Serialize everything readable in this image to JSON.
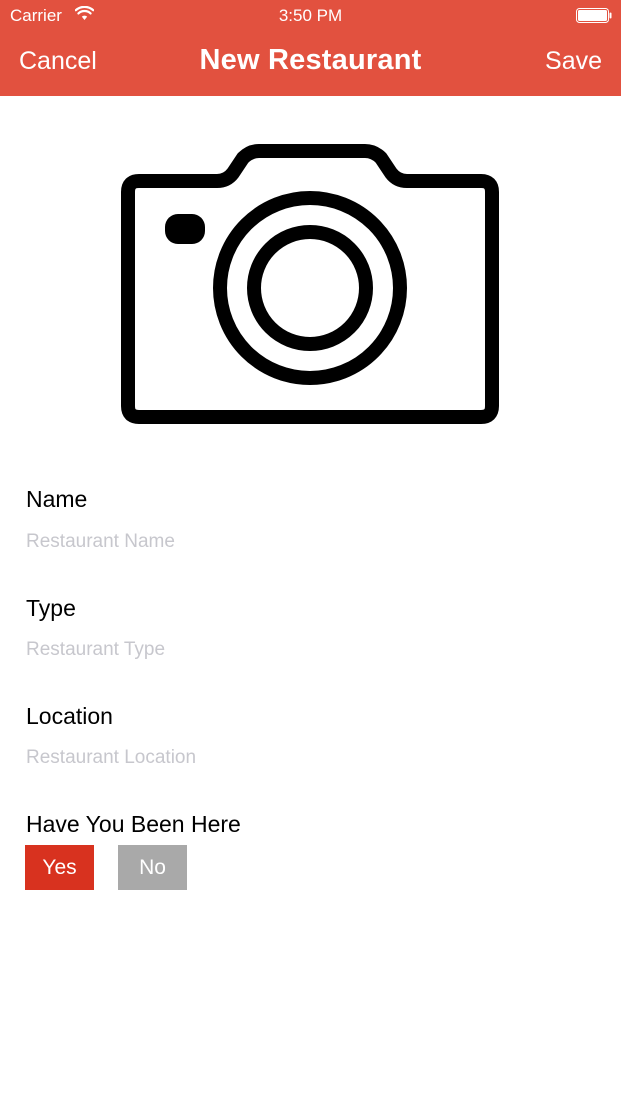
{
  "status_bar": {
    "carrier": "Carrier",
    "time": "3:50 PM",
    "wifi_icon": "wifi-icon",
    "battery_icon": "battery-icon"
  },
  "nav": {
    "cancel": "Cancel",
    "title": "New Restaurant",
    "save": "Save"
  },
  "photo": {
    "icon": "camera-icon"
  },
  "form": {
    "name": {
      "label": "Name",
      "placeholder": "Restaurant Name",
      "value": ""
    },
    "type": {
      "label": "Type",
      "placeholder": "Restaurant Type",
      "value": ""
    },
    "location": {
      "label": "Location",
      "placeholder": "Restaurant Location",
      "value": ""
    },
    "visited": {
      "label": "Have You Been Here",
      "yes": "Yes",
      "no": "No",
      "selected": "Yes"
    }
  },
  "colors": {
    "nav_background": "#e2513f",
    "yes_selected": "#d8321f",
    "no_unselected": "#a9a9a9",
    "placeholder": "#c7c7cd"
  }
}
